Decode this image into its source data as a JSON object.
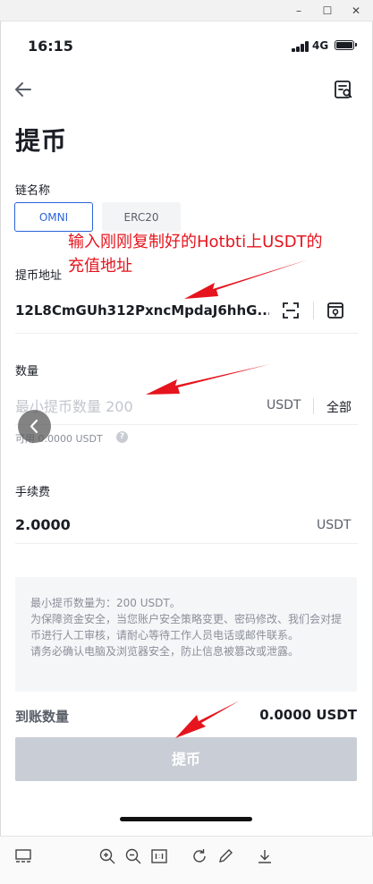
{
  "window_controls": {
    "minimize": "–",
    "maximize": "☐",
    "close": "✕"
  },
  "status_bar": {
    "time": "16:15",
    "network": "4G"
  },
  "header": {
    "back_icon": "arrow-left-icon",
    "record_icon": "record-icon"
  },
  "page_title": "提币",
  "chain": {
    "label": "链名称",
    "options": [
      "OMNI",
      "ERC20"
    ],
    "selected": "OMNI"
  },
  "address": {
    "label": "提币地址",
    "value": "12L8CmGUh312PxncMpdaJ6hhG..."
  },
  "amount": {
    "label": "数量",
    "placeholder": "最小提币数量 200",
    "unit": "USDT",
    "all_label": "全部",
    "available": "可用 0.0000 USDT",
    "help": "?"
  },
  "fee": {
    "label": "手续费",
    "value": "2.0000",
    "unit": "USDT"
  },
  "notice": {
    "line1": "最小提币数量为：200 USDT。",
    "line2": "为保障资金安全，当您账户安全策略变更、密码修改、我们会对提币进行人工审核，请耐心等待工作人员电话或邮件联系。",
    "line3": "请务必确认电脑及浏览器安全，防止信息被篡改或泄露。"
  },
  "receive": {
    "label": "到账数量",
    "value": "0.0000 USDT"
  },
  "submit_label": "提币",
  "annotation": {
    "line1": "输入刚刚复制好的Hotbti上USDT的",
    "line2": "充值地址"
  },
  "colors": {
    "accent": "#2a63d9",
    "annotation": "#e5141d",
    "disabled_button": "#c9ced6"
  }
}
